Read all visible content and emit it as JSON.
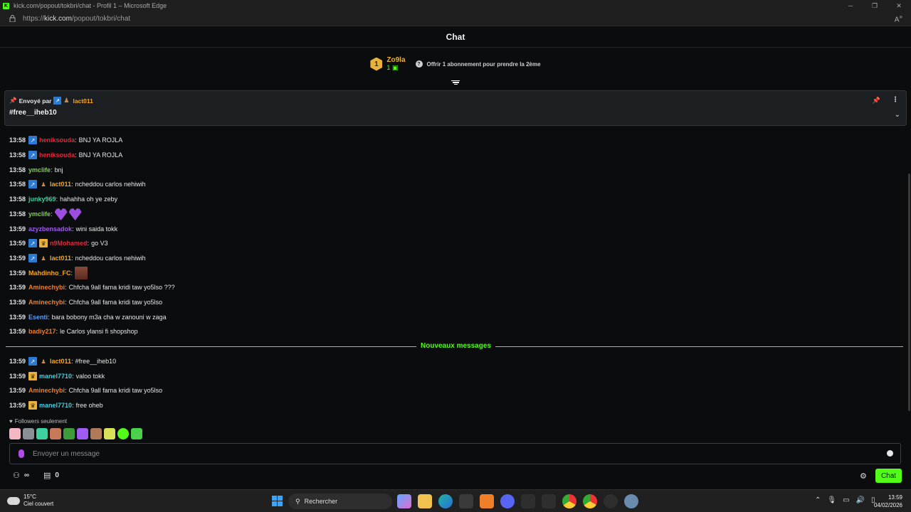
{
  "window": {
    "title": "kick.com/popout/tokbri/chat - Profil 1 – Microsoft Edge",
    "url_prefix": "https://",
    "url_host": "kick.com",
    "url_path": "/popout/tokbri/chat"
  },
  "header": {
    "title": "Chat"
  },
  "leaderboard": {
    "rank": "1",
    "username": "Zo9la",
    "count": "1",
    "offer_text": "Offrir 1 abonnement pour prendre la 2ème"
  },
  "pinned": {
    "sent_by_label": "Envoyé par",
    "username": "lact011",
    "message": "#free__iheb10"
  },
  "messages": [
    {
      "time": "13:58",
      "badges": [
        "arrow"
      ],
      "user": "heniksouda",
      "color": "#e0293d",
      "text": "BNJ YA ROJLA"
    },
    {
      "time": "13:58",
      "badges": [
        "arrow"
      ],
      "user": "heniksouda",
      "color": "#e0293d",
      "text": "BNJ YA ROJLA"
    },
    {
      "time": "13:58",
      "badges": [],
      "user": "ymclife",
      "color": "#7cd34b",
      "text": "bnj"
    },
    {
      "time": "13:58",
      "badges": [
        "arrow",
        "gift"
      ],
      "user": "lact011",
      "color": "#f5a623",
      "text": "ncheddou carlos nehiwih"
    },
    {
      "time": "13:58",
      "badges": [],
      "user": "junky969",
      "color": "#3fd0a0",
      "text": "hahahha oh ye zeby"
    },
    {
      "time": "13:58",
      "badges": [],
      "user": "ymclife",
      "color": "#7cd34b",
      "text": ""
    },
    {
      "time": "13:59",
      "badges": [],
      "user": "azyzbensadok",
      "color": "#a05cf0",
      "text": "wini saida tokk"
    },
    {
      "time": "13:59",
      "badges": [
        "arrow",
        "crown"
      ],
      "user": "n9Mohamed",
      "color": "#e0293d",
      "text": "go V3"
    },
    {
      "time": "13:59",
      "badges": [
        "arrow",
        "gift"
      ],
      "user": "lact011",
      "color": "#f5a623",
      "text": "ncheddou carlos nehiwih"
    },
    {
      "time": "13:59",
      "badges": [],
      "user": "Mahdinho_FC",
      "color": "#f5a623",
      "text": ""
    },
    {
      "time": "13:59",
      "badges": [],
      "user": "Aminechybi",
      "color": "#f07f2a",
      "text": "Chfcha 9all fama kridi taw yo5lso ???"
    },
    {
      "time": "13:59",
      "badges": [],
      "user": "Aminechybi",
      "color": "#f07f2a",
      "text": "Chfcha 9all fama kridi taw yo5lso"
    },
    {
      "time": "13:59",
      "badges": [],
      "user": "Esenti",
      "color": "#5b9df5",
      "text": "bara bobony m3a cha w zanouni w zaga"
    },
    {
      "time": "13:59",
      "badges": [],
      "user": "badiy217",
      "color": "#f07f2a",
      "text": "le Carlos ylansi fi shopshop"
    }
  ],
  "new_messages_label": "Nouveaux messages",
  "new_messages": [
    {
      "time": "13:59",
      "badges": [
        "arrow",
        "gift"
      ],
      "user": "lact011",
      "color": "#f5a623",
      "text": "#free__iheb10"
    },
    {
      "time": "13:59",
      "badges": [
        "crown"
      ],
      "user": "manel7710",
      "color": "#3fd0e0",
      "text": "valoo tokk"
    },
    {
      "time": "13:59",
      "badges": [],
      "user": "Aminechybi",
      "color": "#f07f2a",
      "text": "Chfcha 9all fama kridi taw yo5lso"
    },
    {
      "time": "13:59",
      "badges": [
        "crown"
      ],
      "user": "manel7710",
      "color": "#3fd0e0",
      "text": "free oheb"
    }
  ],
  "followers_label": "Followers seulement",
  "input": {
    "placeholder": "Envoyer un message"
  },
  "footer": {
    "infinity": "∞",
    "points": "0",
    "chat_button": "Chat"
  },
  "taskbar": {
    "temp": "15°C",
    "weather": "Ciel couvert",
    "search_label": "Rechercher",
    "time": "13:59",
    "date": "04/02/2026"
  },
  "colors": {
    "accent": "#53fc18",
    "bg": "#0b0c0d"
  }
}
